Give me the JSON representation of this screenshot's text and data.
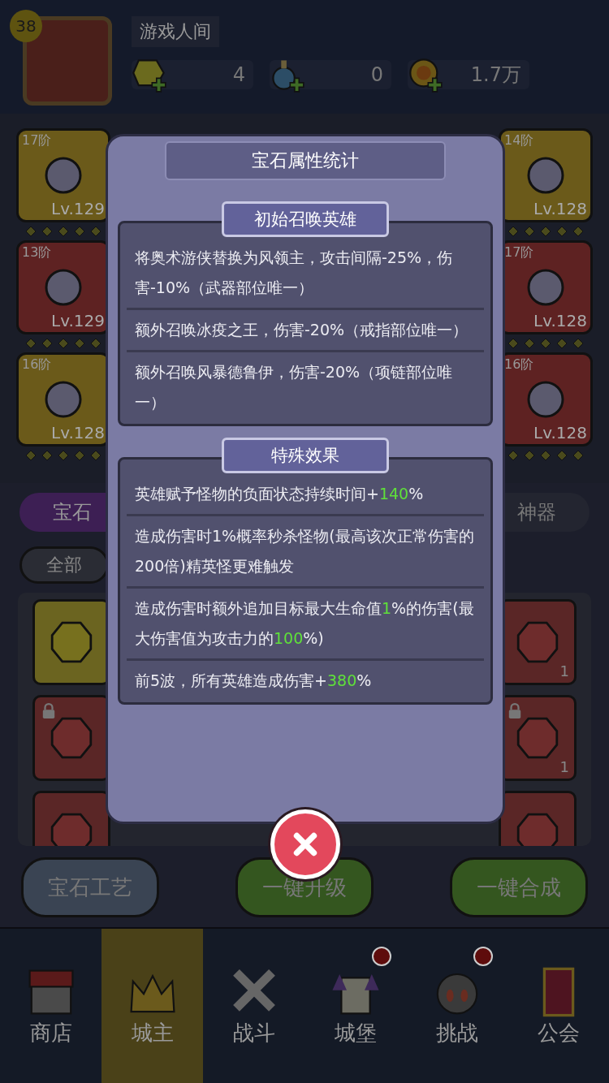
{
  "player": {
    "level": "38",
    "name": "游戏人间"
  },
  "resources": [
    {
      "kind": "gem",
      "value": "4"
    },
    {
      "kind": "potion",
      "value": "0"
    },
    {
      "kind": "coin",
      "value": "1.7万"
    }
  ],
  "equipment_left": [
    {
      "tier": "17阶",
      "level": "Lv.129",
      "kind": "gold"
    },
    {
      "tier": "13阶",
      "level": "Lv.129",
      "kind": "red"
    },
    {
      "tier": "16阶",
      "level": "Lv.128",
      "kind": "gold"
    }
  ],
  "equipment_right": [
    {
      "tier": "14阶",
      "level": "Lv.128",
      "kind": "gold"
    },
    {
      "tier": "17阶",
      "level": "Lv.128",
      "kind": "red"
    },
    {
      "tier": "16阶",
      "level": "Lv.128",
      "kind": "red"
    }
  ],
  "tabs": [
    {
      "label": "宝石",
      "selected": true
    },
    {
      "label": "神器",
      "selected": false
    }
  ],
  "filter": {
    "label": "全部"
  },
  "gems_left": [
    {
      "kind": "yellow",
      "locked": false
    },
    {
      "kind": "red",
      "locked": true
    },
    {
      "kind": "red",
      "locked": false
    }
  ],
  "gems_right": [
    {
      "kind": "red",
      "locked": false,
      "count": "1"
    },
    {
      "kind": "red",
      "locked": true,
      "count": "1"
    },
    {
      "kind": "red",
      "locked": false
    }
  ],
  "buttons": [
    {
      "label": "宝石工艺",
      "kind": "grey"
    },
    {
      "label": "一键升级",
      "kind": "green"
    },
    {
      "label": "一键合成",
      "kind": "green"
    }
  ],
  "nav": [
    {
      "label": "商店",
      "selected": false,
      "badge": false
    },
    {
      "label": "城主",
      "selected": true,
      "badge": false
    },
    {
      "label": "战斗",
      "selected": false,
      "badge": false
    },
    {
      "label": "城堡",
      "selected": false,
      "badge": true
    },
    {
      "label": "挑战",
      "selected": false,
      "badge": true
    },
    {
      "label": "公会",
      "selected": false,
      "badge": false
    }
  ],
  "modal": {
    "title": "宝石属性统计",
    "sections": [
      {
        "header": "初始召唤英雄",
        "items": [
          [
            {
              "text": "将奥术游侠替换为风领主，攻击间隔-25%，伤害-10%（武器部位唯一）",
              "highlight": false
            }
          ],
          [
            {
              "text": "额外召唤冰疫之王，伤害-20%（戒指部位唯一）",
              "highlight": false
            }
          ],
          [
            {
              "text": "额外召唤风暴德鲁伊，伤害-20%（项链部位唯一）",
              "highlight": false
            }
          ]
        ]
      },
      {
        "header": "特殊效果",
        "items": [
          [
            {
              "text": "英雄赋予怪物的负面状态持续时间+",
              "highlight": false
            },
            {
              "text": "140",
              "highlight": true
            },
            {
              "text": "%",
              "highlight": false
            }
          ],
          [
            {
              "text": "造成伤害时1%概率秒杀怪物(最高该次正常伤害的200倍)精英怪更难触发",
              "highlight": false
            }
          ],
          [
            {
              "text": "造成伤害时额外追加目标最大生命值",
              "highlight": false
            },
            {
              "text": "1",
              "highlight": true
            },
            {
              "text": "%的伤害(最大伤害值为攻击力的",
              "highlight": false
            },
            {
              "text": "100",
              "highlight": true
            },
            {
              "text": "%)",
              "highlight": false
            }
          ],
          [
            {
              "text": "前5波，所有英雄造成伤害+",
              "highlight": false
            },
            {
              "text": "380",
              "highlight": true
            },
            {
              "text": "%",
              "highlight": false
            }
          ]
        ]
      }
    ]
  }
}
